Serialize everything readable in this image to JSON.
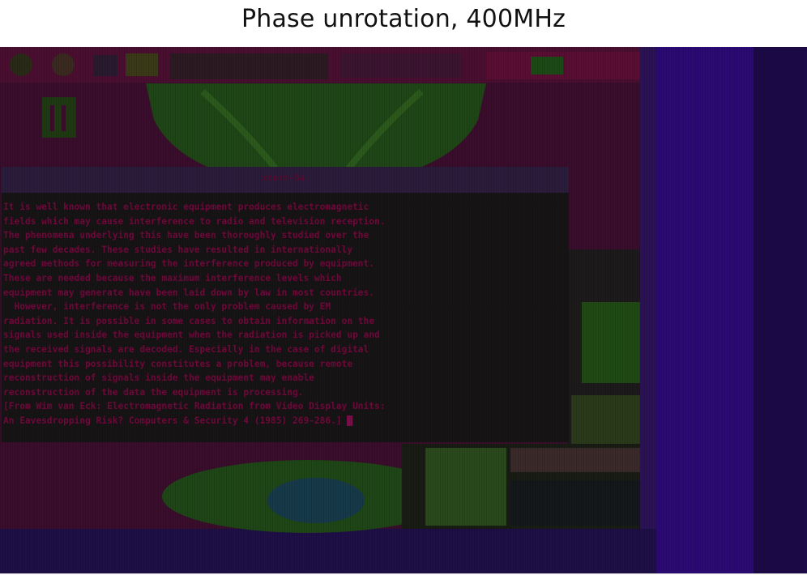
{
  "figure": {
    "title": "Phase unrotation, 400MHz"
  },
  "terminal": {
    "window_title": "xterm-Sa",
    "lines": [
      "It is well known that electronic equipment produces electromagnetic",
      "fields which may cause interference to radio and television reception.",
      "The phenomena underlying this have been thoroughly studied over the",
      "past few decades. These studies have resulted in internationally",
      "agreed methods for measuring the interference produced by equipment.",
      "These are needed because the maximum interference levels which",
      "equipment may generate have been laid down by law in most countries.",
      "  However, interference is not the only problem caused by EM",
      "radiation. It is possible in some cases to obtain information on the",
      "signals used inside the equipment when the radiation is picked up and",
      "the received signals are decoded. Especially in the case of digital",
      "equipment this possibility constitutes a problem, because remote",
      "reconstruction of signals inside the equipment may enable",
      "reconstruction of the data the equipment is processing.",
      "[From Wim van Eck: Electromagnetic Radiation from Video Display Units:",
      "An Eavesdropping Risk? Computers & Security 4 (1985) 269-286.]"
    ]
  },
  "colors": {
    "background": "#3a0d2c",
    "green": "#1e4a14",
    "blue": "#2a0a6e",
    "text": "#6b0b3a"
  }
}
